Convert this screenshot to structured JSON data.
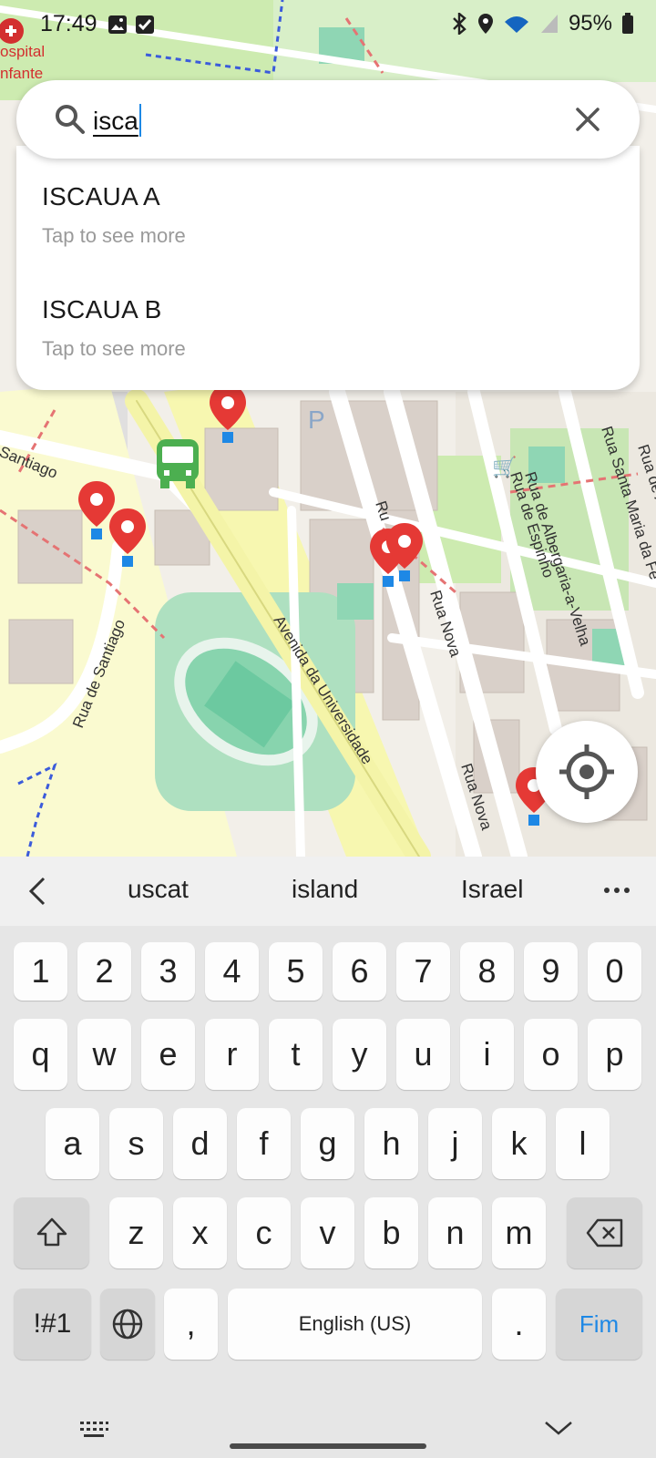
{
  "status_bar": {
    "time": "17:49",
    "battery": "95%",
    "icons": [
      "image-icon",
      "checkbox-icon",
      "bluetooth-icon",
      "location-icon",
      "wifi-icon",
      "signal-icon",
      "battery-icon"
    ]
  },
  "search": {
    "query": "isca",
    "results": [
      {
        "title": "ISCAUA A",
        "subtitle": "Tap to see more"
      },
      {
        "title": "ISCAUA B",
        "subtitle": "Tap to see more"
      }
    ]
  },
  "map": {
    "labels": {
      "hospital": "ospital",
      "infante": "nfante",
      "santiago": "Santiago",
      "rua_santiago": "Rua de Santiago",
      "avenida": "Avenida da Universidade",
      "rua_nova_1": "Rua Nova",
      "rua_nova_2": "Rua Nova",
      "rua_espinho": "Rua de Espinho",
      "rua_albergaria": "Rua de Albergaria-a-Velha",
      "rua_santa_maria": "Rua Santa Maria da Fe",
      "rua_a": "Rua de A",
      "rua_short": "Ru"
    },
    "accent_pin": "#e53935",
    "stop_marker": "#1e88e5",
    "bus_color": "#4caf50"
  },
  "keyboard": {
    "suggestions": [
      "uscat",
      "island",
      "Israel"
    ],
    "row_numbers": [
      "1",
      "2",
      "3",
      "4",
      "5",
      "6",
      "7",
      "8",
      "9",
      "0"
    ],
    "row1": [
      "q",
      "w",
      "e",
      "r",
      "t",
      "y",
      "u",
      "i",
      "o",
      "p"
    ],
    "row2": [
      "a",
      "s",
      "d",
      "f",
      "g",
      "h",
      "j",
      "k",
      "l"
    ],
    "row3": [
      "z",
      "x",
      "c",
      "v",
      "b",
      "n",
      "m"
    ],
    "symbols_label": "!#1",
    "comma": ",",
    "space_label": "English (US)",
    "period": ".",
    "action_label": "Fim",
    "action_color": "#1e88e5"
  }
}
